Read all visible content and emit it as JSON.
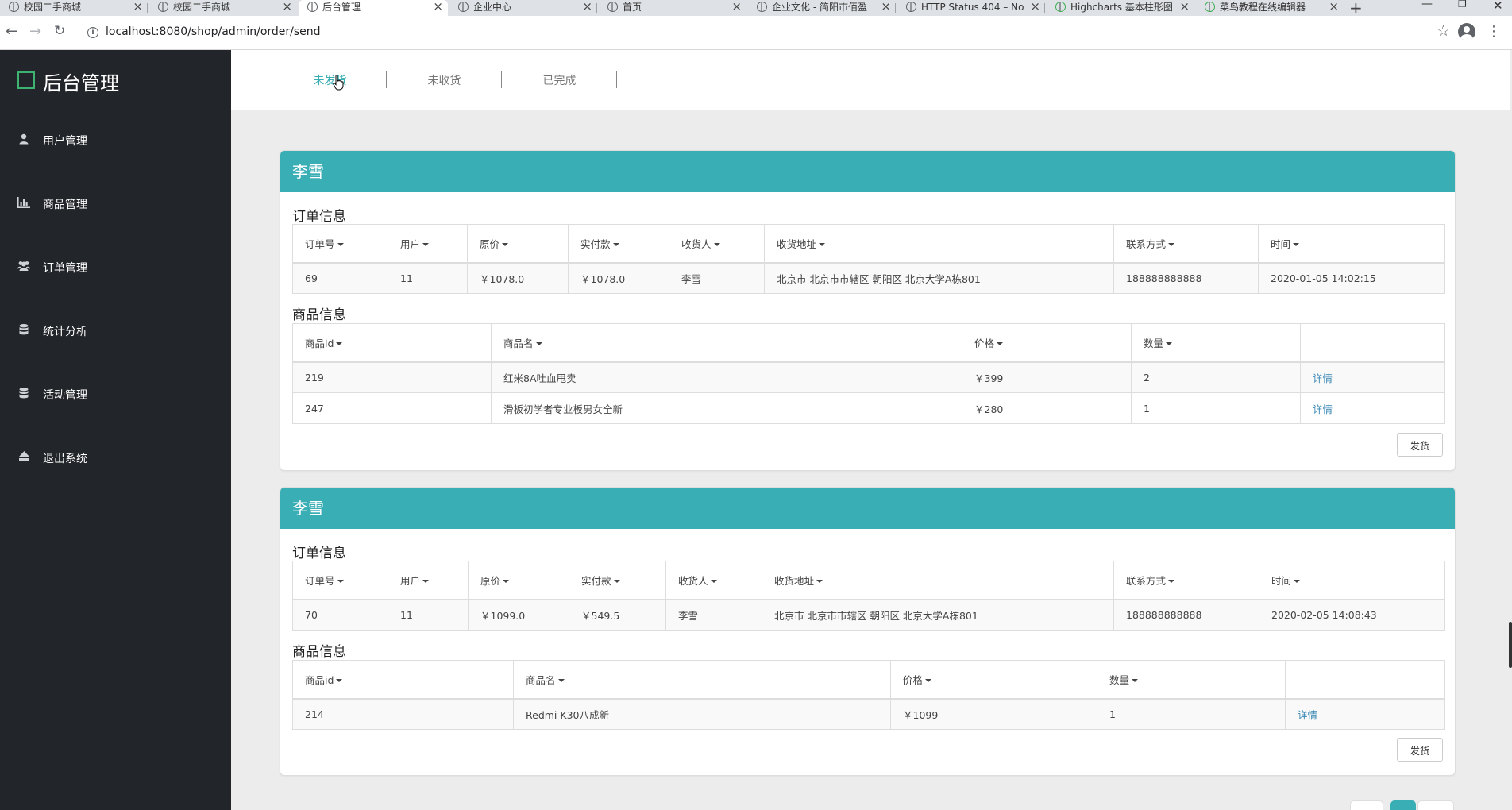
{
  "browser": {
    "tabs": [
      {
        "label": "校园二手商城",
        "icon": "globe-icon"
      },
      {
        "label": "校园二手商城",
        "icon": "globe-icon"
      },
      {
        "label": "后台管理",
        "icon": "globe-icon",
        "active": true
      },
      {
        "label": "企业中心",
        "icon": "globe-icon"
      },
      {
        "label": "首页",
        "icon": "globe-icon"
      },
      {
        "label": "企业文化 - 简阳市佰盈",
        "icon": "globe-icon"
      },
      {
        "label": "HTTP Status 404 – No",
        "icon": "globe-icon"
      },
      {
        "label": "Highcharts 基本柱形图",
        "icon": "runoob-icon"
      },
      {
        "label": "菜鸟教程在线编辑器",
        "icon": "runoob-icon"
      }
    ],
    "url": "localhost:8080/shop/admin/order/send"
  },
  "sidebar": {
    "brand": "后台管理",
    "items": [
      {
        "label": "用户管理",
        "icon": "user-icon"
      },
      {
        "label": "商品管理",
        "icon": "bar-chart-icon"
      },
      {
        "label": "订单管理",
        "icon": "users-icon"
      },
      {
        "label": "统计分析",
        "icon": "database-icon"
      },
      {
        "label": "活动管理",
        "icon": "database-icon"
      },
      {
        "label": "退出系统",
        "icon": "eject-icon"
      }
    ]
  },
  "topnav": {
    "tabs": [
      "未发货",
      "未收货",
      "已完成"
    ],
    "active_index": 0
  },
  "labels": {
    "order_info": "订单信息",
    "goods_info": "商品信息",
    "ship_button": "发货",
    "detail_link": "详情"
  },
  "order_columns": [
    "订单号",
    "用户",
    "原价",
    "实付款",
    "收货人",
    "收货地址",
    "联系方式",
    "时间"
  ],
  "goods_columns": [
    "商品id",
    "商品名",
    "价格",
    "数量",
    ""
  ],
  "orders": [
    {
      "customer": "李雪",
      "order": {
        "id": "69",
        "user": "11",
        "original_price": "￥1078.0",
        "paid": "￥1078.0",
        "receiver": "李雪",
        "address": "北京市 北京市市辖区 朝阳区 北京大学A栋801",
        "phone": "188888888888",
        "time": "2020-01-05 14:02:15"
      },
      "goods": [
        {
          "id": "219",
          "name": "红米8A吐血甩卖",
          "price": "￥399",
          "qty": "2"
        },
        {
          "id": "247",
          "name": "滑板初学者专业板男女全新",
          "price": "￥280",
          "qty": "1"
        }
      ]
    },
    {
      "customer": "李雪",
      "order": {
        "id": "70",
        "user": "11",
        "original_price": "￥1099.0",
        "paid": "￥549.5",
        "receiver": "李雪",
        "address": "北京市 北京市市辖区 朝阳区 北京大学A栋801",
        "phone": "188888888888",
        "time": "2020-02-05 14:08:43"
      },
      "goods": [
        {
          "id": "214",
          "name": "Redmi K30八成新",
          "price": "￥1099",
          "qty": "1"
        }
      ]
    }
  ]
}
